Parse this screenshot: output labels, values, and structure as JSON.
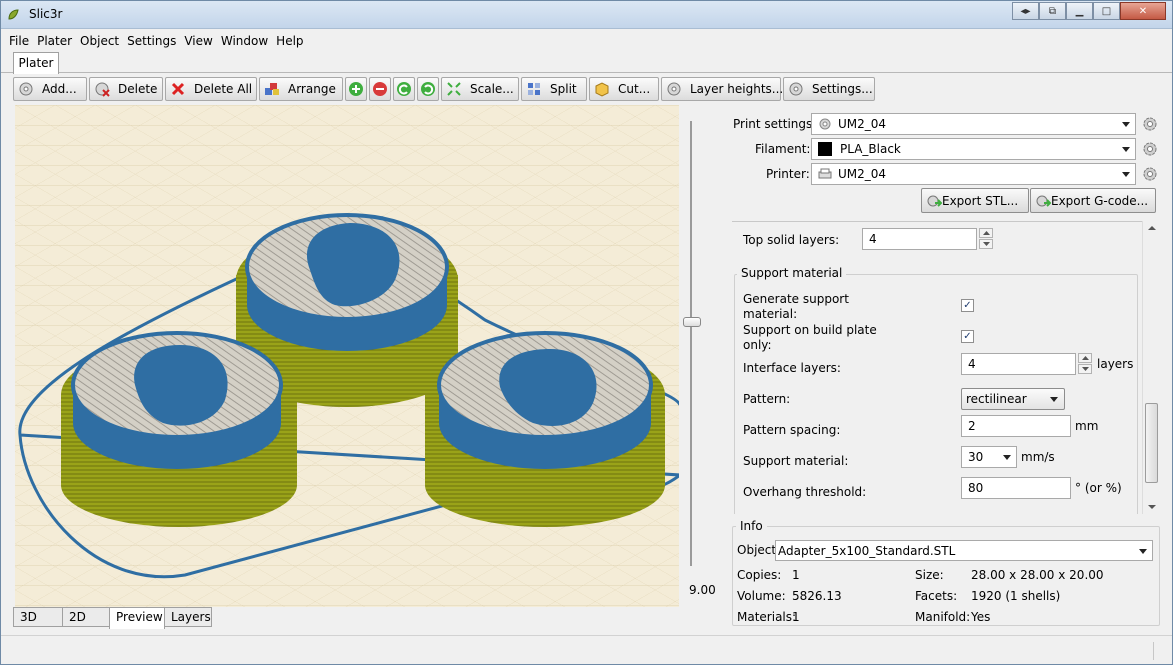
{
  "window": {
    "title": "Slic3r"
  },
  "menu": [
    "File",
    "Plater",
    "Object",
    "Settings",
    "View",
    "Window",
    "Help"
  ],
  "main_tab": "Plater",
  "toolbar": {
    "add": "Add...",
    "delete": "Delete",
    "delete_all": "Delete All",
    "arrange": "Arrange",
    "scale": "Scale...",
    "split": "Split",
    "cut": "Cut...",
    "layer_heights": "Layer heights...",
    "settings": "Settings..."
  },
  "slider_value": "9.00",
  "view_tabs": [
    "3D",
    "2D",
    "Preview",
    "Layers"
  ],
  "presets": {
    "print_label": "Print settings:",
    "print_value": "UM2_04",
    "filament_label": "Filament:",
    "filament_value": "PLA_Black",
    "printer_label": "Printer:",
    "printer_value": "UM2_04"
  },
  "export": {
    "stl": "Export STL...",
    "gcode": "Export G-code..."
  },
  "settings": {
    "top_solid_label": "Top solid layers:",
    "top_solid_value": "4",
    "support_group": "Support material",
    "generate_support_label_1": "Generate support",
    "generate_support_label_2": "material:",
    "build_plate_label_1": "Support on build plate",
    "build_plate_label_2": "only:",
    "interface_label": "Interface layers:",
    "interface_value": "4",
    "interface_unit": "layers",
    "pattern_label": "Pattern:",
    "pattern_value": "rectilinear",
    "spacing_label": "Pattern spacing:",
    "spacing_value": "2",
    "spacing_unit": "mm",
    "speed_label": "Support material:",
    "speed_value": "30",
    "speed_unit": "mm/s",
    "overhang_label": "Overhang threshold:",
    "overhang_value": "80",
    "overhang_unit": "° (or %)"
  },
  "info": {
    "title": "Info",
    "object_label": "Object:",
    "object_value": "Adapter_5x100_Standard.STL",
    "copies_label": "Copies:",
    "copies_value": "1",
    "size_label": "Size:",
    "size_value": "28.00 x 28.00 x 20.00",
    "volume_label": "Volume:",
    "volume_value": "5826.13",
    "facets_label": "Facets:",
    "facets_value": "1920 (1 shells)",
    "materials_label": "Materials:",
    "materials_value": "1",
    "manifold_label": "Manifold:",
    "manifold_value": "Yes"
  },
  "colors": {
    "support": "#9aa319",
    "perimeter": "#2f6ea3",
    "infill": "#c9c6bd",
    "bed": "#f4ecd7"
  }
}
